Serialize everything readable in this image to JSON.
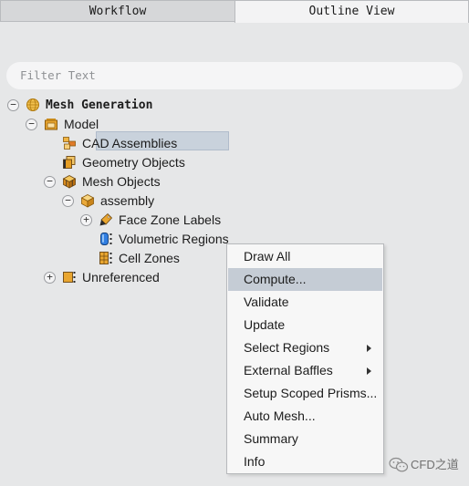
{
  "tabs": {
    "workflow": "Workflow",
    "outline_view": "Outline View",
    "active": "outline_view"
  },
  "filter": {
    "placeholder": "Filter Text"
  },
  "tree": {
    "root": {
      "label": "Mesh Generation",
      "expander": "−",
      "icon": "globe-icon"
    },
    "model": {
      "label": "Model",
      "expander": "−",
      "icon": "model-box-icon"
    },
    "cad_assemblies": {
      "label": "CAD Assemblies",
      "icon": "cad-assemblies-icon"
    },
    "geometry_objects": {
      "label": "Geometry Objects",
      "icon": "geometry-objects-icon"
    },
    "mesh_objects": {
      "label": "Mesh Objects",
      "expander": "−",
      "icon": "mesh-objects-icon"
    },
    "assembly": {
      "label": "assembly",
      "expander": "−",
      "icon": "assembly-cube-icon"
    },
    "face_zone_labels": {
      "label": "Face Zone Labels",
      "expander": "+",
      "icon": "face-zone-labels-icon"
    },
    "volumetric_regions": {
      "label": "Volumetric Regions",
      "icon": "volumetric-regions-icon",
      "selected": true
    },
    "cell_zones": {
      "label": "Cell Zones",
      "icon": "cell-zones-icon"
    },
    "unreferenced": {
      "label": "Unreferenced",
      "expander": "+",
      "icon": "unreferenced-icon"
    }
  },
  "context_menu": {
    "items": [
      {
        "label": "Draw All"
      },
      {
        "label": "Compute...",
        "highlighted": true
      },
      {
        "label": "Validate"
      },
      {
        "label": "Update"
      },
      {
        "label": "Select Regions",
        "submenu": true
      },
      {
        "label": "External Baffles",
        "submenu": true
      },
      {
        "label": "Setup Scoped Prisms..."
      },
      {
        "label": "Auto Mesh..."
      },
      {
        "label": "Summary"
      },
      {
        "label": "Info"
      }
    ]
  },
  "watermark": {
    "text": "CFD之道",
    "icon": "wechat-icon"
  },
  "colors": {
    "background": "#e6e7e8",
    "selection": "#c9d2dc",
    "menu_highlight": "#c5ccd5",
    "icon_orange": "#e0a526"
  }
}
